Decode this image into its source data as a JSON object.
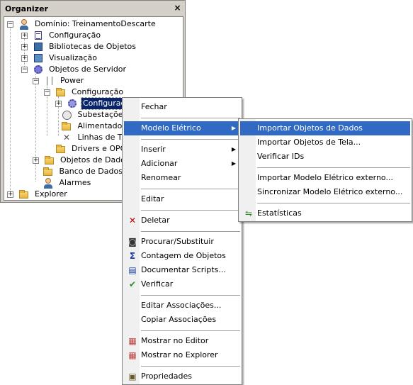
{
  "organizer": {
    "title": "Organizer",
    "close": "×",
    "tree": [
      {
        "label": "Domínio: TreinamentoDescarte",
        "icon": "domain-icon"
      },
      {
        "label": "Configuração",
        "icon": "config-icon"
      },
      {
        "label": "Bibliotecas de Objetos",
        "icon": "library-icon"
      },
      {
        "label": "Visualização",
        "icon": "screen-icon"
      },
      {
        "label": "Objetos de Servidor",
        "icon": "server-objects-icon"
      },
      {
        "label": "Power",
        "icon": "power-icon"
      },
      {
        "label": "Configuração",
        "icon": "folder-icon"
      },
      {
        "label": "Configuração",
        "icon": "gear-icon"
      },
      {
        "label": "Subestações",
        "icon": "substation-icon"
      },
      {
        "label": "Alimentadores",
        "icon": "feeder-icon"
      },
      {
        "label": "Linhas de Tran",
        "icon": "transmission-icon"
      },
      {
        "label": "Drivers e OPC",
        "icon": "folder-icon"
      },
      {
        "label": "Objetos de Dados",
        "icon": "folder-icon"
      },
      {
        "label": "Banco de Dados",
        "icon": "folder-icon"
      },
      {
        "label": "Alarmes",
        "icon": "alarm-icon"
      },
      {
        "label": "Explorer",
        "icon": "folder-icon"
      }
    ]
  },
  "context_menu": {
    "items": [
      {
        "label": "Fechar"
      },
      {
        "label": "Modelo Elétrico",
        "submenu": true,
        "highlighted": true
      },
      {
        "label": "Inserir",
        "submenu": true
      },
      {
        "label": "Adicionar",
        "submenu": true
      },
      {
        "label": "Renomear"
      },
      {
        "label": "Editar"
      },
      {
        "label": "Deletar",
        "icon": "delete-icon"
      },
      {
        "label": "Procurar/Substituir",
        "icon": "binoculars-icon"
      },
      {
        "label": "Contagem de Objetos",
        "icon": "sigma-icon"
      },
      {
        "label": "Documentar Scripts...",
        "icon": "document-icon"
      },
      {
        "label": "Verificar",
        "icon": "verify-icon"
      },
      {
        "label": "Editar Associações..."
      },
      {
        "label": "Copiar Associações"
      },
      {
        "label": "Mostrar no Editor",
        "icon": "editor-icon"
      },
      {
        "label": "Mostrar no Explorer",
        "icon": "explorer-icon"
      },
      {
        "label": "Propriedades",
        "icon": "properties-icon"
      }
    ]
  },
  "submenu": {
    "items": [
      {
        "label": "Importar Objetos de Dados",
        "highlighted": true
      },
      {
        "label": "Importar Objetos de Tela..."
      },
      {
        "label": "Verificar IDs"
      },
      {
        "label": "Importar Modelo Elétrico externo..."
      },
      {
        "label": "Sincronizar Modelo Elétrico externo..."
      },
      {
        "label": "Estatísticas",
        "icon": "statistics-icon"
      }
    ]
  },
  "colors": {
    "highlight": "#316ac5",
    "selection": "#0a246a"
  }
}
